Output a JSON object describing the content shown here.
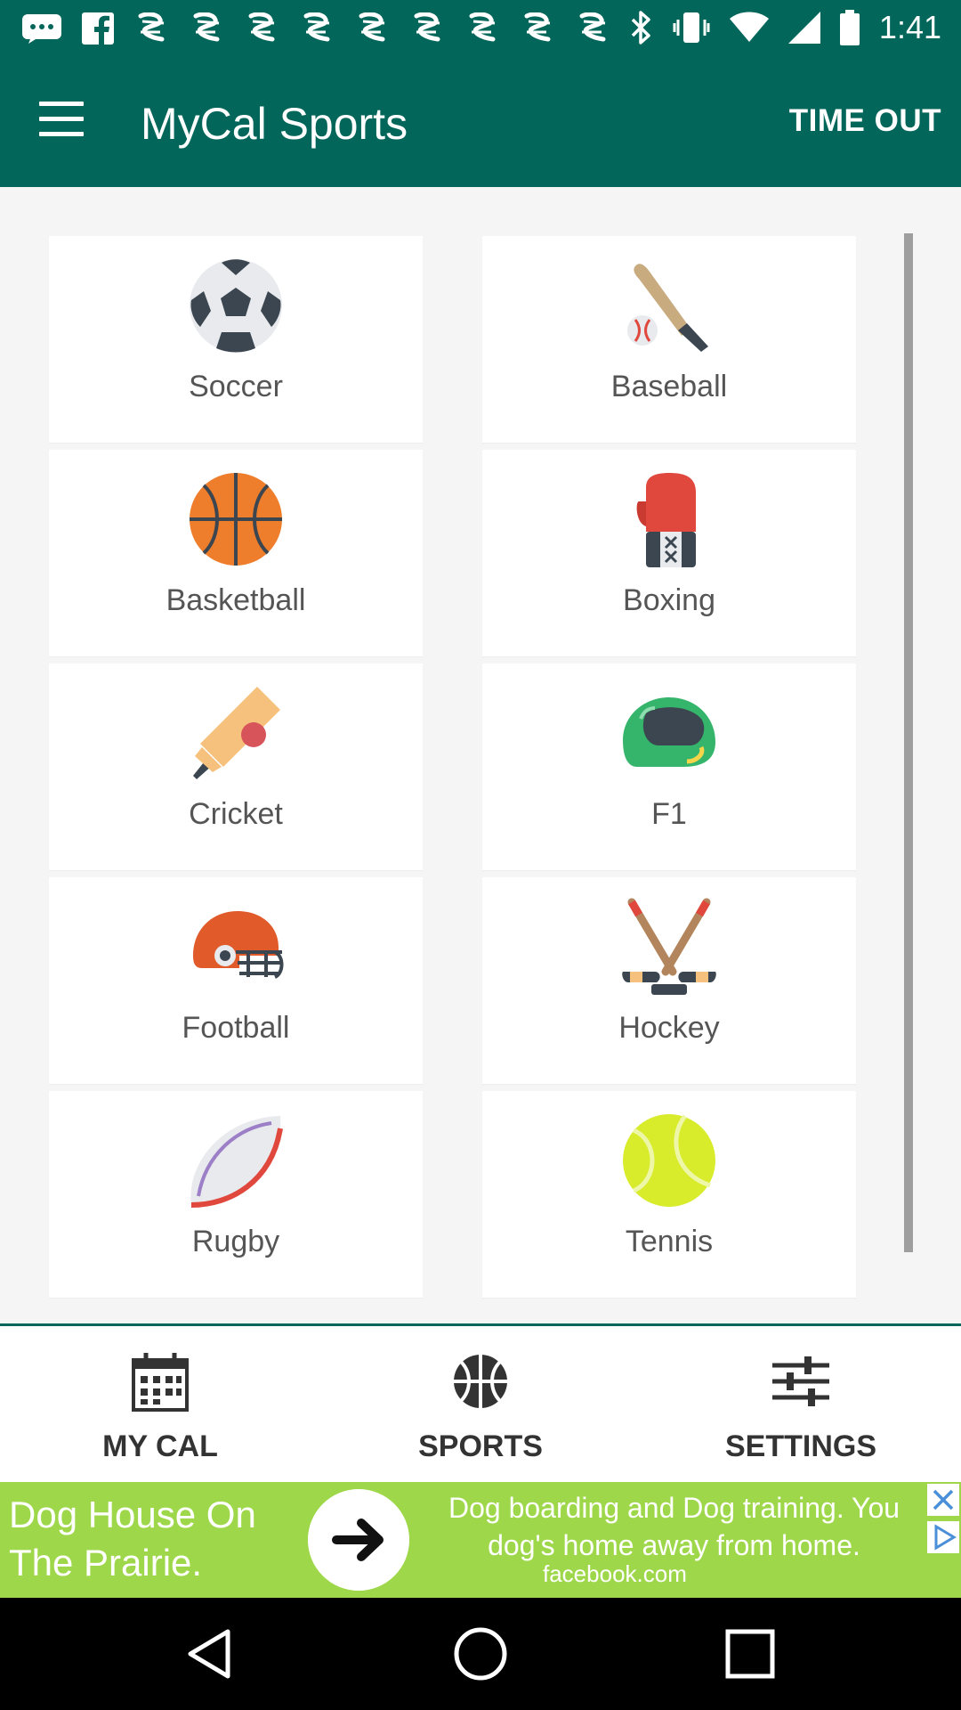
{
  "status_bar": {
    "time": "1:41",
    "left_icons": [
      "message-icon",
      "facebook-icon",
      "app-notification-icon",
      "app-notification-icon",
      "app-notification-icon",
      "app-notification-icon",
      "app-notification-icon",
      "app-notification-icon",
      "app-notification-icon",
      "app-notification-icon",
      "app-notification-icon"
    ],
    "right_icons": [
      "bluetooth-icon",
      "vibrate-icon",
      "wifi-icon",
      "signal-icon",
      "battery-icon"
    ]
  },
  "app_bar": {
    "title": "MyCal Sports",
    "action_label": "TIME OUT",
    "color": "#03665a"
  },
  "sports": [
    {
      "label": "Soccer",
      "icon": "soccer-ball-icon"
    },
    {
      "label": "Baseball",
      "icon": "baseball-bat-icon"
    },
    {
      "label": "Basketball",
      "icon": "basketball-icon"
    },
    {
      "label": "Boxing",
      "icon": "boxing-glove-icon"
    },
    {
      "label": "Cricket",
      "icon": "cricket-bat-icon"
    },
    {
      "label": "F1",
      "icon": "racing-helmet-icon"
    },
    {
      "label": "Football",
      "icon": "football-helmet-icon"
    },
    {
      "label": "Hockey",
      "icon": "hockey-sticks-icon"
    },
    {
      "label": "Rugby",
      "icon": "rugby-ball-icon"
    },
    {
      "label": "Tennis",
      "icon": "tennis-ball-icon"
    }
  ],
  "bottom_nav": [
    {
      "label": "MY CAL",
      "icon": "calendar-icon"
    },
    {
      "label": "SPORTS",
      "icon": "ball-icon"
    },
    {
      "label": "SETTINGS",
      "icon": "sliders-icon"
    }
  ],
  "ad": {
    "headline": "Dog House On The Prairie.",
    "body_line1": "Dog boarding and Dog training. You",
    "body_line2": "dog's home away from home.",
    "link": "facebook.com",
    "color": "#9ed84a"
  }
}
